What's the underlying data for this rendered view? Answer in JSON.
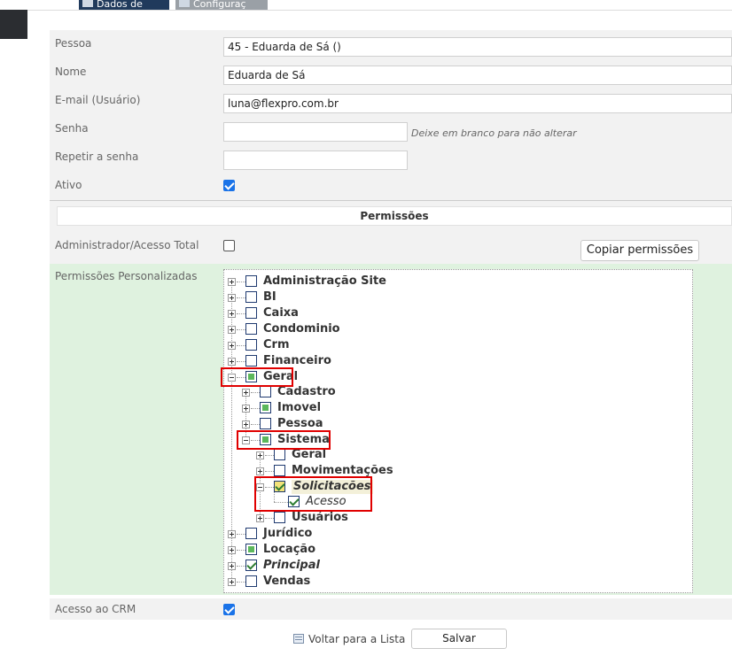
{
  "top_tabs": [
    {
      "label": "Dados de"
    },
    {
      "label": "Configuraç"
    }
  ],
  "fields": {
    "pessoa": {
      "label": "Pessoa",
      "value": "45 - Eduarda de Sá ()"
    },
    "nome": {
      "label": "Nome",
      "value": "Eduarda de Sá"
    },
    "email": {
      "label": "E-mail (Usuário)",
      "value": "luna@flexpro.com.br"
    },
    "senha": {
      "label": "Senha",
      "value": "",
      "hint": "Deixe em branco para não alterar"
    },
    "repetir_senha": {
      "label": "Repetir a senha",
      "value": ""
    },
    "ativo": {
      "label": "Ativo",
      "checked": true
    }
  },
  "permissions": {
    "header": "Permissões",
    "admin_label": "Administrador/Acesso Total",
    "admin_checked": false,
    "copy_button": "Copiar permissões",
    "custom_label": "Permissões Personalizadas",
    "tree": [
      {
        "label": "Administração Site",
        "state": "none",
        "expanded": false,
        "italic": false
      },
      {
        "label": "BI",
        "state": "none",
        "expanded": false,
        "italic": false
      },
      {
        "label": "Caixa",
        "state": "none",
        "expanded": false,
        "italic": false
      },
      {
        "label": "Condominio",
        "state": "none",
        "expanded": false,
        "italic": false
      },
      {
        "label": "Crm",
        "state": "none",
        "expanded": false,
        "italic": false
      },
      {
        "label": "Financeiro",
        "state": "none",
        "expanded": false,
        "italic": false
      },
      {
        "label": "Geral",
        "state": "partial",
        "expanded": true,
        "italic": false,
        "children": [
          {
            "label": "Cadastro",
            "state": "none",
            "expanded": false
          },
          {
            "label": "Imovel",
            "state": "partial",
            "expanded": false
          },
          {
            "label": "Pessoa",
            "state": "none",
            "expanded": false
          },
          {
            "label": "Sistema",
            "state": "partial",
            "expanded": true,
            "children": [
              {
                "label": "Geral",
                "state": "none",
                "expanded": false
              },
              {
                "label": "Movimentações",
                "state": "none",
                "expanded": false
              },
              {
                "label": "Solicitacões",
                "state": "checked",
                "expanded": true,
                "italic": true,
                "children": [
                  {
                    "label": "Acesso",
                    "state": "checked",
                    "italic": true
                  }
                ]
              },
              {
                "label": "Usuários",
                "state": "none",
                "expanded": false
              }
            ]
          }
        ]
      },
      {
        "label": "Jurídico",
        "state": "none",
        "expanded": false,
        "italic": false
      },
      {
        "label": "Locação",
        "state": "partial",
        "expanded": false,
        "italic": false
      },
      {
        "label": "Principal",
        "state": "checked",
        "expanded": false,
        "italic": true
      },
      {
        "label": "Vendas",
        "state": "none",
        "expanded": false,
        "italic": false
      }
    ]
  },
  "crm": {
    "label": "Acesso ao CRM",
    "checked": true
  },
  "footer": {
    "back_label": "Voltar para a Lista",
    "save_label": "Salvar"
  },
  "colors": {
    "accent": "#1a73e8",
    "partial": "#5cb85c",
    "highlight_box": "#e00000",
    "tab_dark": "#203a5c"
  }
}
